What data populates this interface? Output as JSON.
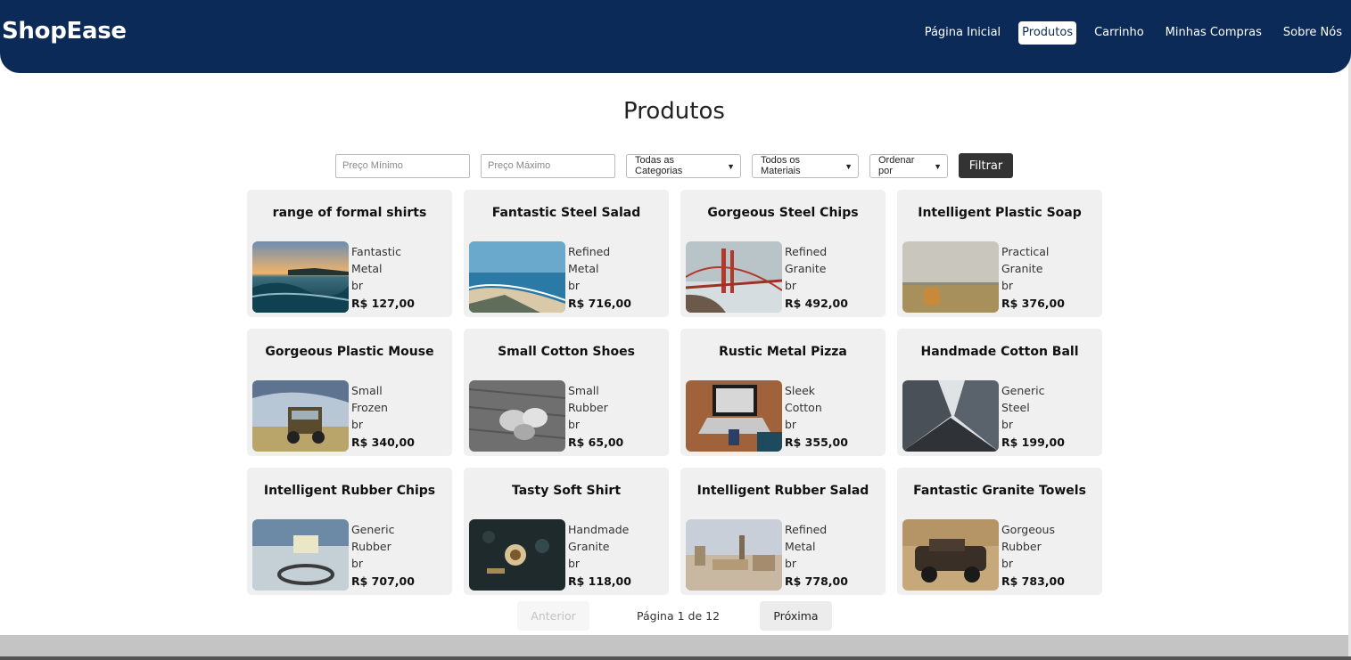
{
  "brand": "ShopEase",
  "nav": [
    {
      "label": "Página Inicial",
      "active": false
    },
    {
      "label": "Produtos",
      "active": true
    },
    {
      "label": "Carrinho",
      "active": false
    },
    {
      "label": "Minhas Compras",
      "active": false
    },
    {
      "label": "Sobre Nós",
      "active": false
    }
  ],
  "page_title": "Produtos",
  "filters": {
    "min_price_placeholder": "Preço Mínimo",
    "max_price_placeholder": "Preço Máximo",
    "category_selected": "Todas as Categorias",
    "material_selected": "Todos os Materiais",
    "order_selected": "Ordenar por",
    "filter_button": "Filtrar"
  },
  "products": [
    {
      "name": "range of formal shirts",
      "line1": "Fantastic",
      "line2": "Metal",
      "line3": "br",
      "price": "R$ 127,00",
      "image": "ocean-wave-sunset"
    },
    {
      "name": "Fantastic Steel Salad",
      "line1": "Refined",
      "line2": "Metal",
      "line3": "br",
      "price": "R$ 716,00",
      "image": "aerial-beach"
    },
    {
      "name": "Gorgeous Steel Chips",
      "line1": "Refined",
      "line2": "Granite",
      "line3": "br",
      "price": "R$ 492,00",
      "image": "golden-gate-bridge"
    },
    {
      "name": "Intelligent Plastic Soap",
      "line1": "Practical",
      "line2": "Granite",
      "line3": "br",
      "price": "R$ 376,00",
      "image": "hay-bale-field"
    },
    {
      "name": "Gorgeous Plastic Mouse",
      "line1": "Small",
      "line2": "Frozen",
      "line3": "br",
      "price": "R$ 340,00",
      "image": "vintage-truck"
    },
    {
      "name": "Small Cotton Shoes",
      "line1": "Small",
      "line2": "Rubber",
      "line3": "br",
      "price": "R$ 65,00",
      "image": "pine-cones"
    },
    {
      "name": "Rustic Metal Pizza",
      "line1": "Sleek",
      "line2": "Cotton",
      "line3": "br",
      "price": "R$ 355,00",
      "image": "laptop-desk"
    },
    {
      "name": "Handmade Cotton Ball",
      "line1": "Generic",
      "line2": "Steel",
      "line3": "br",
      "price": "R$ 199,00",
      "image": "skyscrapers"
    },
    {
      "name": "Intelligent Rubber Chips",
      "line1": "Generic",
      "line2": "Rubber",
      "line3": "br",
      "price": "R$ 707,00",
      "image": "sign-on-ground"
    },
    {
      "name": "Tasty Soft Shirt",
      "line1": "Handmade",
      "line2": "Granite",
      "line3": "br",
      "price": "R$ 118,00",
      "image": "tea-table"
    },
    {
      "name": "Intelligent Rubber Salad",
      "line1": "Refined",
      "line2": "Metal",
      "line3": "br",
      "price": "R$ 778,00",
      "image": "city-skyline"
    },
    {
      "name": "Fantastic Granite Towels",
      "line1": "Gorgeous",
      "line2": "Rubber",
      "line3": "br",
      "price": "R$ 783,00",
      "image": "vintage-car"
    }
  ],
  "pagination": {
    "prev_label": "Anterior",
    "info": "Página 1 de 12",
    "next_label": "Próxima"
  }
}
